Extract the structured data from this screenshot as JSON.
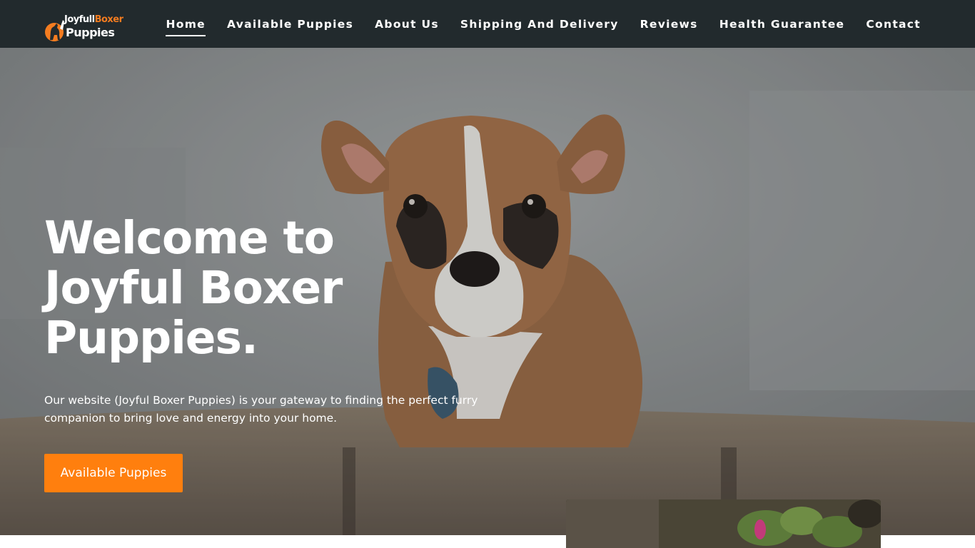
{
  "header": {
    "logo": {
      "line1_a": "Joyfull",
      "line1_b": "Boxer",
      "line2": "Puppies",
      "icon": "dog-silhouette-icon"
    },
    "nav": [
      {
        "label": "Home",
        "active": true
      },
      {
        "label": "Available Puppies",
        "active": false
      },
      {
        "label": "About Us",
        "active": false
      },
      {
        "label": "Shipping And Delivery",
        "active": false
      },
      {
        "label": "Reviews",
        "active": false
      },
      {
        "label": "Health Guarantee",
        "active": false
      },
      {
        "label": "Contact",
        "active": false
      }
    ]
  },
  "hero": {
    "title_line1": "Welcome to",
    "title_line2": "Joyful Boxer",
    "title_line3": "Puppies.",
    "subtitle": " Our website (Joyful Boxer Puppies) is your gateway to finding the perfect furry companion to bring love and energy into your home.",
    "cta_label": "Available Puppies"
  },
  "colors": {
    "header_bg": "#222a2d",
    "accent": "#ff7f0e",
    "logo_accent": "#f47c20",
    "text": "#ffffff"
  }
}
